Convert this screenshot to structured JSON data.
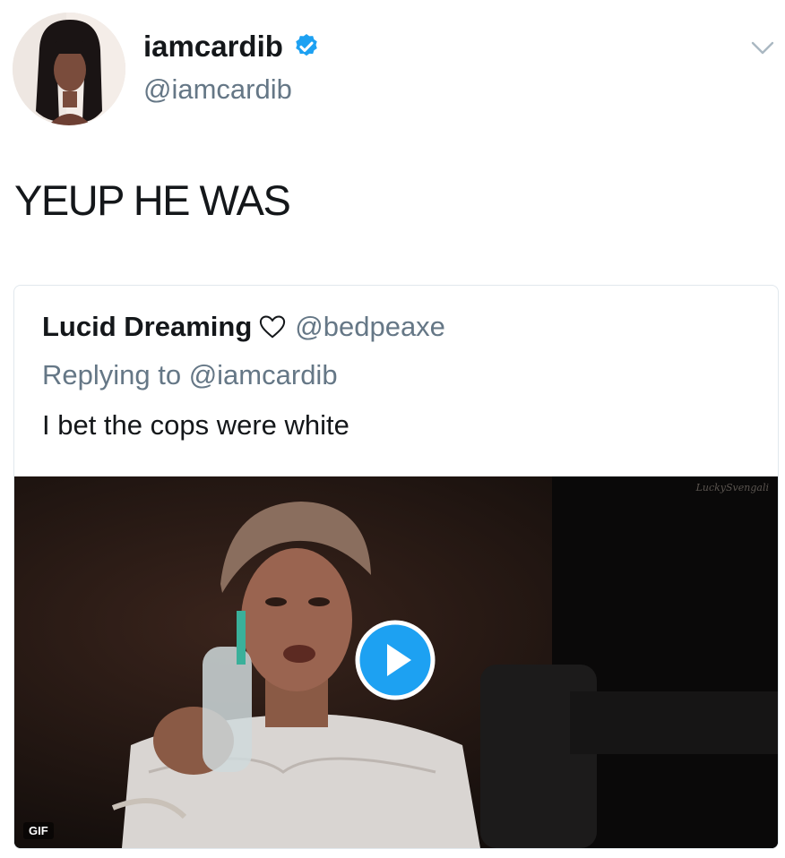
{
  "tweet": {
    "display_name": "iamcardib",
    "handle": "@iamcardib",
    "text": "YEUP HE WAS",
    "avatar_icon": "profile-photo",
    "verified_icon": "verified-badge-icon",
    "caret_icon": "chevron-down-icon"
  },
  "quoted": {
    "display_name": "Lucid Dreaming",
    "heart_icon": "heart-outline-icon",
    "handle": "@bedpeaxe",
    "reply_line": "Replying to @iamcardib",
    "text": "I bet the cops were white",
    "media": {
      "watermark": "LuckySvengali",
      "badge": "GIF",
      "play_icon": "play-icon"
    }
  },
  "colors": {
    "accent": "#1da1f2",
    "text": "#14171a",
    "muted": "#657786",
    "border": "#e1e8ed"
  }
}
